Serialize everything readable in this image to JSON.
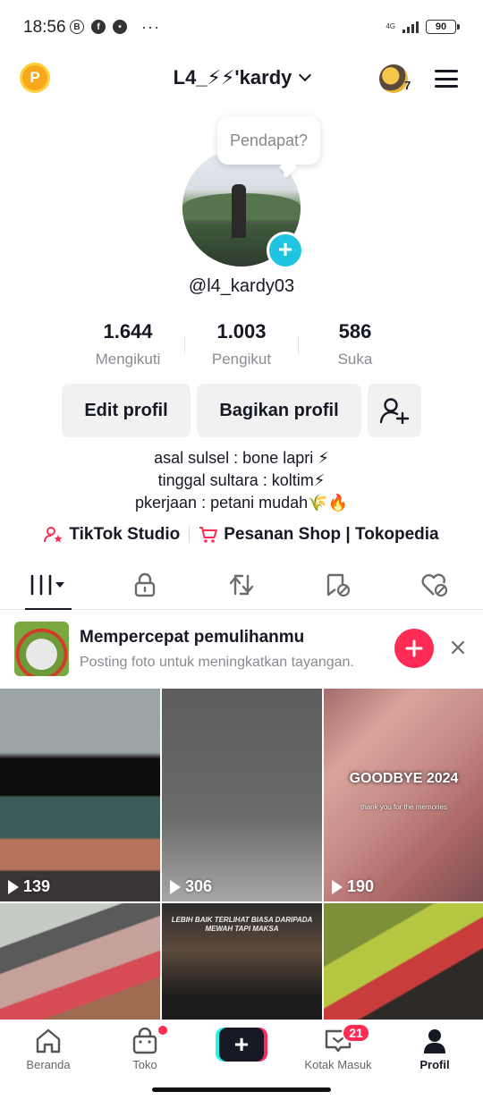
{
  "status": {
    "time": "18:56",
    "network": "4G",
    "battery": "90"
  },
  "header": {
    "coin_label": "P",
    "account_name": "L4_⚡⚡'kardy",
    "notif_count": "7"
  },
  "profile": {
    "bubble_text": "Pendapat?",
    "username": "@l4_kardy03",
    "stats": [
      {
        "value": "1.644",
        "label": "Mengikuti"
      },
      {
        "value": "1.003",
        "label": "Pengikut"
      },
      {
        "value": "586",
        "label": "Suka"
      }
    ],
    "buttons": {
      "edit": "Edit profil",
      "share": "Bagikan profil"
    },
    "bio": [
      "asal sulsel : bone lapri ⚡",
      "tinggal sultara : koltim⚡",
      "pkerjaan : petani mudah🌾🔥"
    ],
    "links": {
      "studio": "TikTok Studio",
      "shop": "Pesanan Shop | Tokopedia"
    }
  },
  "banner": {
    "title": "Mempercepat pemulihanmu",
    "subtitle": "Posting foto untuk meningkatkan tayangan."
  },
  "videos": [
    {
      "views": "139"
    },
    {
      "views": "306"
    },
    {
      "views": "190",
      "overlay_title": "GOODBYE 2024",
      "overlay_sub": "thank you for the memories"
    },
    {},
    {
      "caption": "LEBIH BAIK TERLIHAT BIASA DARIPADA MEWAH TAPI MAKSA"
    },
    {}
  ],
  "bottom_nav": {
    "home": "Beranda",
    "shop": "Toko",
    "create": "+",
    "inbox": "Kotak Masuk",
    "inbox_badge": "21",
    "profile": "Profil"
  },
  "colors": {
    "accent": "#fe2c55",
    "cyan": "#25f4ee",
    "badge_blue": "#20c4e0"
  }
}
